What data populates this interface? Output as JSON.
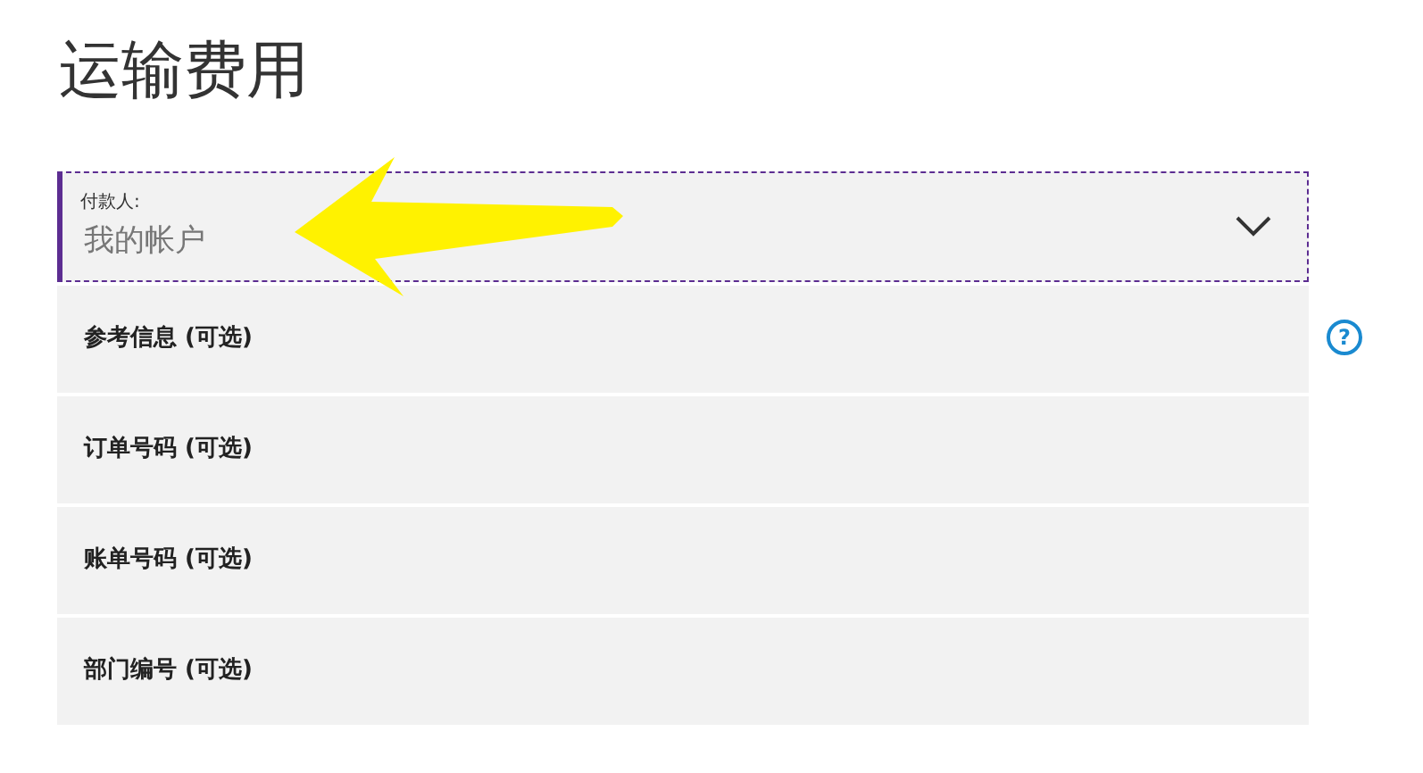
{
  "title": "运输费用",
  "payer": {
    "label": "付款人:",
    "value": "我的帐户",
    "focused": true
  },
  "fields": [
    {
      "label": "参考信息 (可选)",
      "help": "?"
    },
    {
      "label": "订单号码 (可选)"
    },
    {
      "label": "账单号码 (可选)"
    },
    {
      "label": "部门编号 (可选)"
    }
  ],
  "annotation": {
    "kind": "arrow"
  }
}
